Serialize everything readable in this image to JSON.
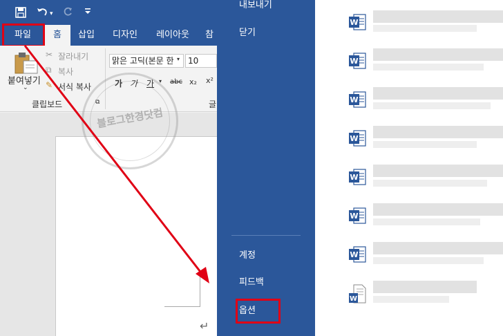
{
  "quick_access": {
    "save_icon": "save-icon",
    "undo_icon": "undo-icon",
    "redo_icon": "redo-icon",
    "customize_icon": "customize-qat-icon"
  },
  "tabs": [
    {
      "label": "파일"
    },
    {
      "label": "홈"
    },
    {
      "label": "삽입"
    },
    {
      "label": "디자인"
    },
    {
      "label": "레이아웃"
    },
    {
      "label": "참"
    }
  ],
  "ribbon": {
    "paste_label": "붙여넣기",
    "cut_label": "잘라내기",
    "copy_label": "복사",
    "format_painter_label": "서식 복사",
    "clipboard_group_label": "클립보드",
    "font_name": "맑은 고딕(본문 한",
    "font_size": "10",
    "bold": "가",
    "italic": "가",
    "underline": "가",
    "strike": "abc",
    "subscript": "x₂",
    "superscript": "x²",
    "font_group_label": "글"
  },
  "watermark": {
    "text": "블로그한경닷컴"
  },
  "backstage": {
    "items_top": [
      {
        "label": "내보내기"
      },
      {
        "label": "닫기"
      }
    ],
    "items_bottom": [
      {
        "label": "계정"
      },
      {
        "label": "피드백"
      },
      {
        "label": "옵션"
      }
    ]
  },
  "colors": {
    "word_blue": "#2b579a",
    "highlight_red": "#e00015"
  }
}
